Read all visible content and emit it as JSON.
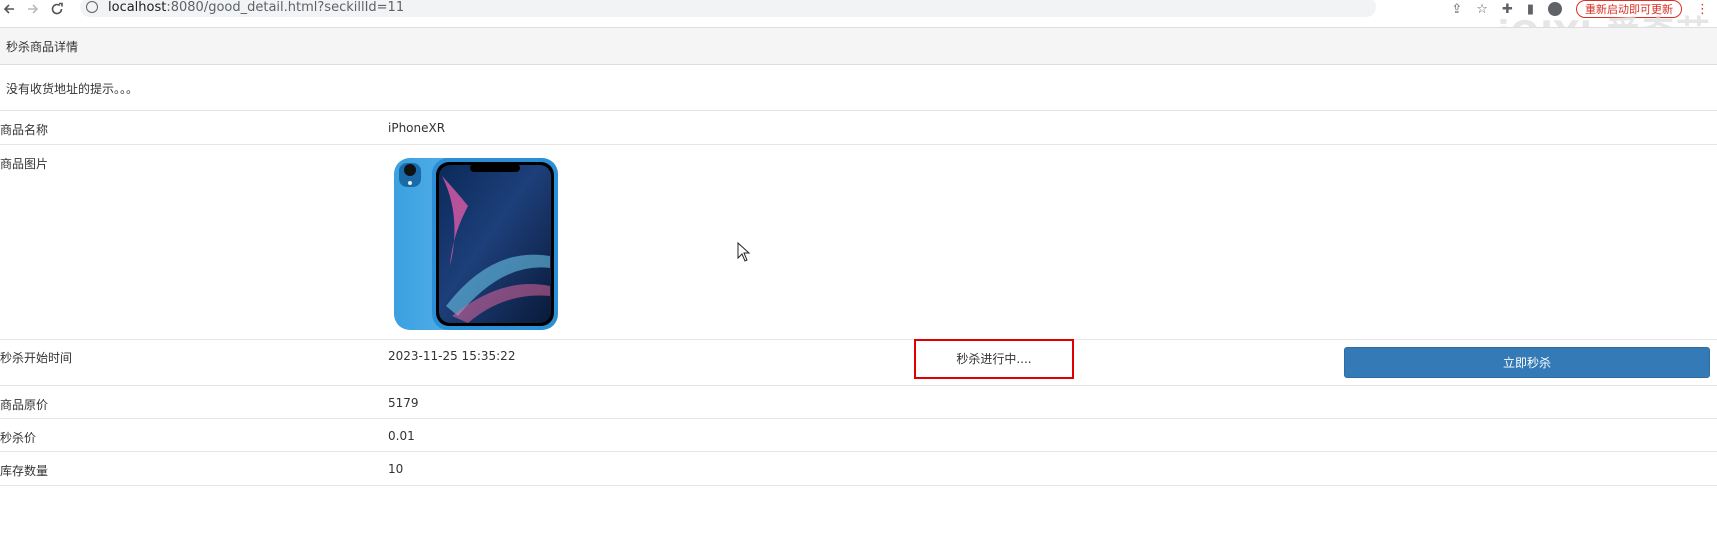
{
  "browser": {
    "url_host": "localhost",
    "url_path": ":8080/good_detail.html?seckillId=11",
    "update_label": "重新启动即可更新",
    "watermark": "iQIYI 爱奇艺"
  },
  "panel": {
    "title": "秒杀商品详情",
    "notice": "没有收货地址的提示。。。"
  },
  "goods": {
    "name_label": "商品名称",
    "name_value": "iPhoneXR",
    "image_label": "商品图片",
    "start_label": "秒杀开始时间",
    "start_value": "2023-11-25 15:35:22",
    "status_text": "秒杀进行中....",
    "buy_button_label": "立即秒杀",
    "original_price_label": "商品原价",
    "original_price_value": "5179",
    "seckill_price_label": "秒杀价",
    "seckill_price_value": "0.01",
    "stock_label": "库存数量",
    "stock_value": "10"
  },
  "colors": {
    "primary_button": "#337ab7",
    "status_border": "#e00000"
  }
}
